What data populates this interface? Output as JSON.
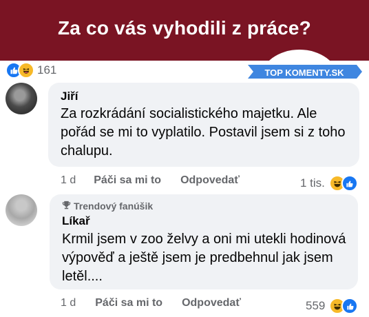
{
  "header": {
    "title": "Za co vás vyhodili z práce?"
  },
  "post": {
    "reaction_count": "161"
  },
  "badge": {
    "text": "TOP KOMENTY.SK",
    "color": "#3f86e0"
  },
  "comments": [
    {
      "author": "Jiří",
      "text": "Za rozkrádání socialistického majetku. Ale pořád se mi to vyplatilo. Postavil jsem si z toho chalupu.",
      "time": "1 d",
      "like_label": "Páči sa mi to",
      "reply_label": "Odpovedať",
      "reaction_count": "1 tis."
    },
    {
      "badge": "Trendový fanúšik",
      "author": "Líkař",
      "text": "Krmil jsem v zoo želvy a oni mi utekli hodinová výpověď a ještě jsem je predbehnul jak jsem letěl....",
      "time": "1 d",
      "like_label": "Páči sa mi to",
      "reply_label": "Odpovedať",
      "reaction_count": "559"
    }
  ],
  "icons": [
    "like-icon",
    "haha-icon",
    "trophy-icon",
    "speech-bubble-icon"
  ],
  "colors": {
    "header_bg": "#7a1423",
    "like_blue": "#1877f2",
    "haha_yellow": "#f7b928",
    "bubble_bg": "#f0f2f5"
  }
}
